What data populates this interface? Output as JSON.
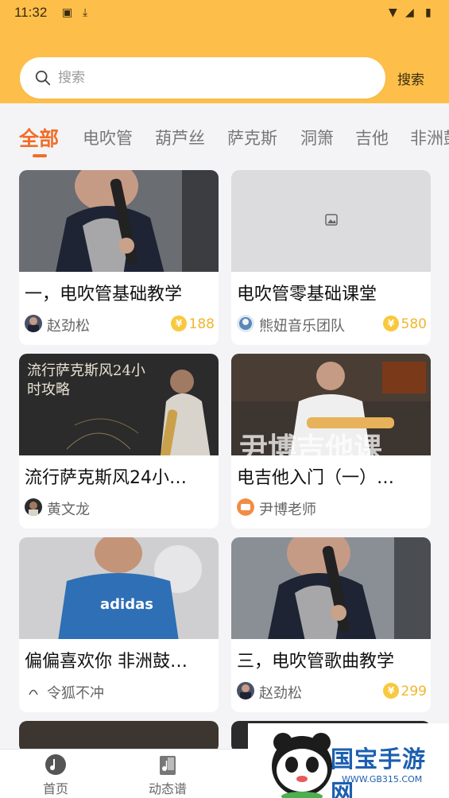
{
  "status": {
    "time": "11:32"
  },
  "search": {
    "placeholder": "搜索",
    "button": "搜索"
  },
  "tabs": [
    {
      "label": "全部",
      "active": true
    },
    {
      "label": "电吹管"
    },
    {
      "label": "葫芦丝"
    },
    {
      "label": "萨克斯"
    },
    {
      "label": "洞箫"
    },
    {
      "label": "吉他"
    },
    {
      "label": "非洲鼓"
    }
  ],
  "cards": [
    {
      "title": "一，电吹管基础教学",
      "author": "赵劲松",
      "price": "188",
      "thumb": "photo"
    },
    {
      "title": "电吹管零基础课堂",
      "author": "熊妞音乐团队",
      "price": "580",
      "thumb": "placeholder"
    },
    {
      "title": "流行萨克斯风24小…",
      "author": "黄文龙",
      "thumb_text": "流行萨克斯风24小时攻略"
    },
    {
      "title": "电吉他入门（一）…",
      "author": "尹博老师",
      "thumb_text": "尹博吉他课"
    },
    {
      "title": "偏偏喜欢你 非洲鼓…",
      "author": "令狐不冲",
      "thumb_text": "adidas"
    },
    {
      "title": "三，电吹管歌曲教学",
      "author": "赵劲松",
      "price": "299"
    }
  ],
  "nav": [
    {
      "label": "首页",
      "icon": "home-disc-icon"
    },
    {
      "label": "动态谱",
      "icon": "sheet-music-icon"
    }
  ],
  "watermark": {
    "text": "国宝手游网",
    "url": "WWW.GB315.COM"
  },
  "colors": {
    "accent": "#fdbf4a",
    "active_tab": "#f06e2a",
    "price": "#f2b52d"
  }
}
